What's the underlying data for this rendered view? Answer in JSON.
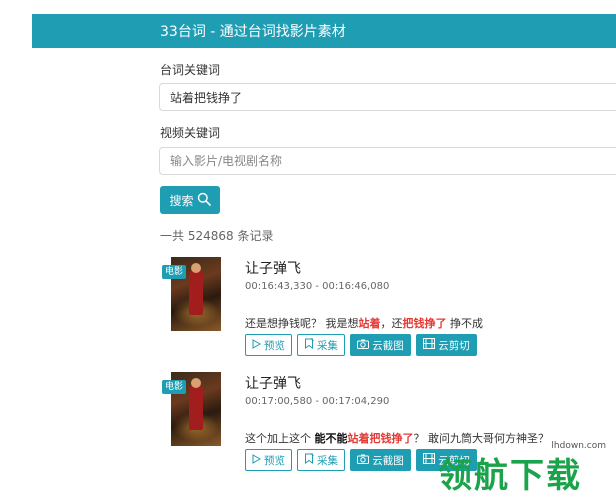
{
  "header": {
    "title": "33台词 - 通过台词找影片素材"
  },
  "form": {
    "keyword_label": "台词关键词",
    "keyword_value": "站着把钱挣了",
    "video_label": "视频关键词",
    "video_placeholder": "输入影片/电视剧名称",
    "search_label": "搜索"
  },
  "total_text": "一共 524868 条记录",
  "results": [
    {
      "badge": "电影",
      "title": "让子弹飞",
      "time": "00:16:43,330 - 00:16:46,080",
      "line_parts": [
        "还是想挣钱呢？ 我是想",
        "站着",
        "，还",
        "把钱挣了",
        " 挣不成"
      ]
    },
    {
      "badge": "电影",
      "title": "让子弹飞",
      "time": "00:17:00,580 - 00:17:04,290",
      "line_parts": [
        "这个加上这个 ",
        "能不能",
        "站着把钱挣了",
        "？ 敢问九筒大哥何方神圣？"
      ]
    }
  ],
  "buttons": {
    "preview": "预览",
    "collect": "采集",
    "screenshot": "云截图",
    "clip": "云剪切"
  },
  "watermark": {
    "url": "lhdown.com",
    "text": "领航下载"
  },
  "colors": {
    "accent": "#1f9db3",
    "highlight": "#e53935",
    "watermark": "#1aa34a"
  },
  "icons": {
    "search": "search-icon",
    "preview": "play-outline-icon",
    "collect": "bookmark-icon",
    "screenshot": "camera-icon",
    "clip": "film-icon"
  }
}
